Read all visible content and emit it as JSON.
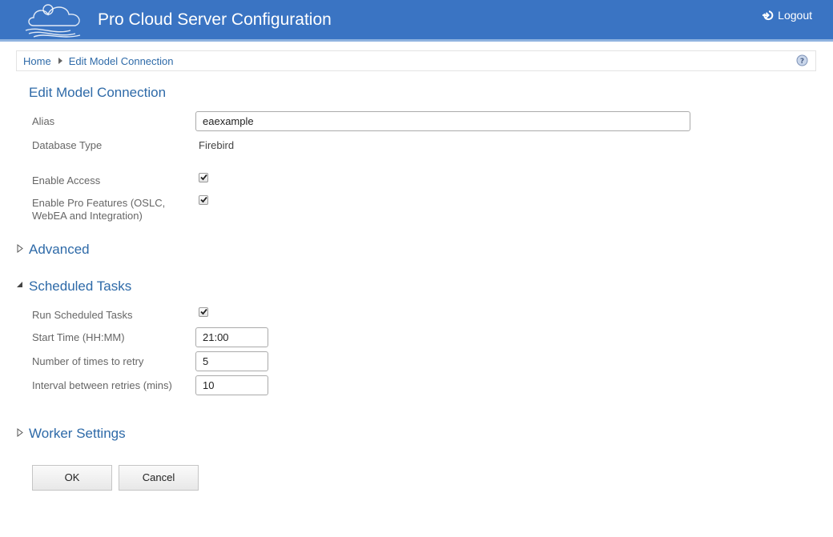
{
  "header": {
    "title": "Pro Cloud Server Configuration",
    "logout_label": "Logout"
  },
  "breadcrumb": {
    "home": "Home",
    "current": "Edit Model Connection"
  },
  "page_title": "Edit Model Connection",
  "form": {
    "alias_label": "Alias",
    "alias_value": "eaexample",
    "db_type_label": "Database Type",
    "db_type_value": "Firebird",
    "enable_access_label": "Enable Access",
    "enable_access_checked": true,
    "pro_features_label_line1": "Enable Pro Features (OSLC,",
    "pro_features_label_line2": "WebEA and Integration)",
    "pro_features_checked": true
  },
  "sections": {
    "advanced": {
      "title": "Advanced",
      "expanded": false
    },
    "scheduled": {
      "title": "Scheduled Tasks",
      "expanded": true
    },
    "worker": {
      "title": "Worker Settings",
      "expanded": false
    }
  },
  "scheduled": {
    "run_label": "Run Scheduled Tasks",
    "run_checked": true,
    "start_label": "Start Time (HH:MM)",
    "start_value": "21:00",
    "retry_label": "Number of times to retry",
    "retry_value": "5",
    "interval_label": "Interval between retries (mins)",
    "interval_value": "10"
  },
  "buttons": {
    "ok": "OK",
    "cancel": "Cancel"
  },
  "colors": {
    "header_bg": "#3a74c3",
    "link": "#2e6aa8"
  }
}
